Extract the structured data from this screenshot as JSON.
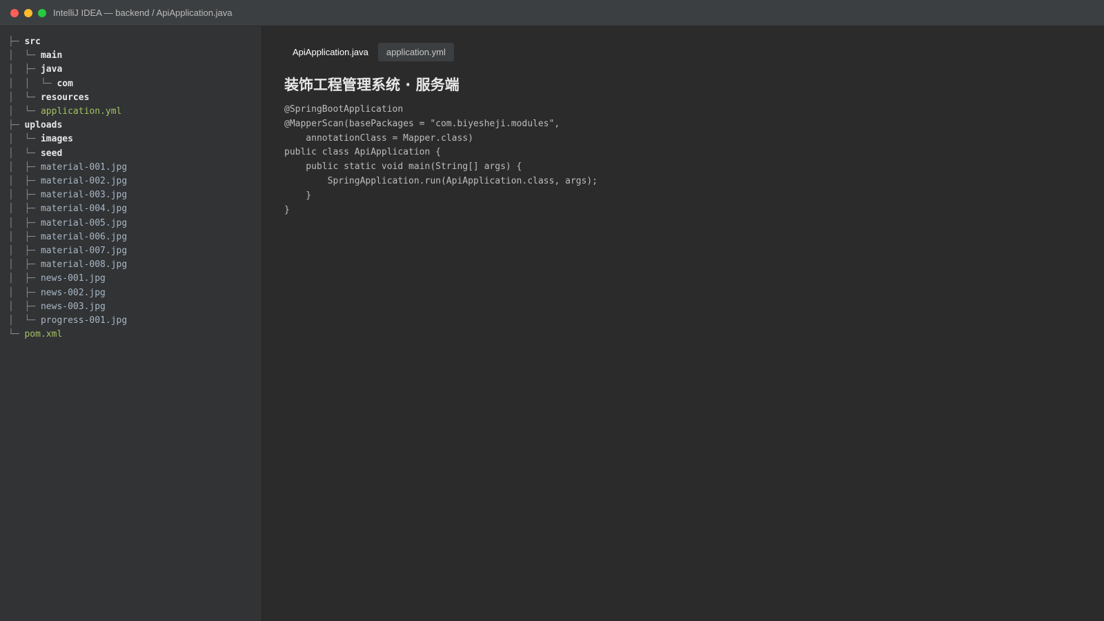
{
  "window": {
    "title": "IntelliJ IDEA — backend / ApiApplication.java"
  },
  "sidebar": {
    "tree": [
      {
        "prefix": "├─ ",
        "name": "src",
        "kind": "dir"
      },
      {
        "prefix": "│  └─ ",
        "name": "main",
        "kind": "dir"
      },
      {
        "prefix": "│  ├─ ",
        "name": "java",
        "kind": "dir"
      },
      {
        "prefix": "│  │  └─ ",
        "name": "com",
        "kind": "dir"
      },
      {
        "prefix": "│  └─ ",
        "name": "resources",
        "kind": "dir"
      },
      {
        "prefix": "│  └─ ",
        "name": "application.yml",
        "kind": "config"
      },
      {
        "prefix": "├─ ",
        "name": "uploads",
        "kind": "dir"
      },
      {
        "prefix": "│  └─ ",
        "name": "images",
        "kind": "dir"
      },
      {
        "prefix": "│  └─ ",
        "name": "seed",
        "kind": "dir"
      },
      {
        "prefix": "│  ├─ ",
        "name": "material-001.jpg",
        "kind": "file"
      },
      {
        "prefix": "│  ├─ ",
        "name": "material-002.jpg",
        "kind": "file"
      },
      {
        "prefix": "│  ├─ ",
        "name": "material-003.jpg",
        "kind": "file"
      },
      {
        "prefix": "│  ├─ ",
        "name": "material-004.jpg",
        "kind": "file"
      },
      {
        "prefix": "│  ├─ ",
        "name": "material-005.jpg",
        "kind": "file"
      },
      {
        "prefix": "│  ├─ ",
        "name": "material-006.jpg",
        "kind": "file"
      },
      {
        "prefix": "│  ├─ ",
        "name": "material-007.jpg",
        "kind": "file"
      },
      {
        "prefix": "│  ├─ ",
        "name": "material-008.jpg",
        "kind": "file"
      },
      {
        "prefix": "│  ├─ ",
        "name": "news-001.jpg",
        "kind": "file"
      },
      {
        "prefix": "│  ├─ ",
        "name": "news-002.jpg",
        "kind": "file"
      },
      {
        "prefix": "│  ├─ ",
        "name": "news-003.jpg",
        "kind": "file"
      },
      {
        "prefix": "│  └─ ",
        "name": "progress-001.jpg",
        "kind": "file"
      },
      {
        "prefix": "└─ ",
        "name": "pom.xml",
        "kind": "config"
      }
    ]
  },
  "editor": {
    "tabs": [
      {
        "label": "ApiApplication.java",
        "active": true
      },
      {
        "label": "application.yml",
        "active": false
      }
    ],
    "heading": "装饰工程管理系统 · 服务端",
    "code_lines": [
      "@SpringBootApplication",
      "@MapperScan(basePackages = \"com.biyesheji.modules\",",
      "    annotationClass = Mapper.class)",
      "public class ApiApplication {",
      "    public static void main(String[] args) {",
      "        SpringApplication.run(ApiApplication.class, args);",
      "    }",
      "}"
    ]
  },
  "colors": {
    "dir": "#e8e8e8",
    "file": "#a9b7c6",
    "config": "#a5c261"
  }
}
